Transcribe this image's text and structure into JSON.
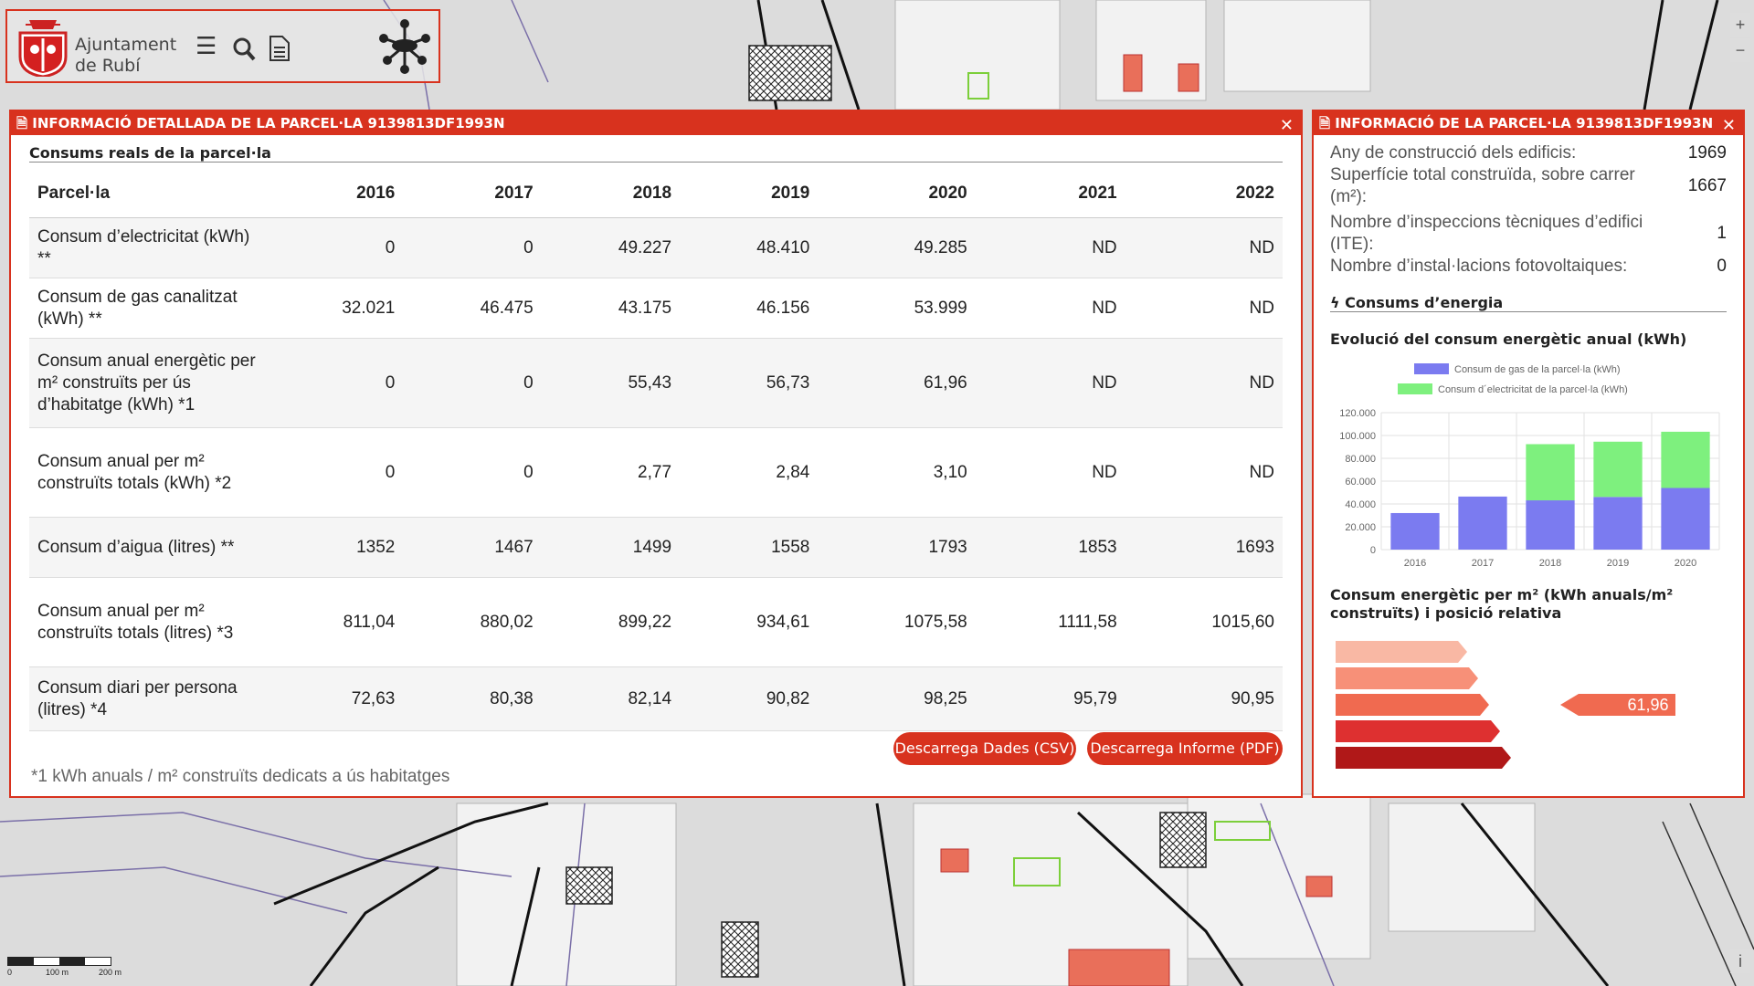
{
  "header": {
    "logo_line1": "Ajuntament",
    "logo_line2": "de Rubí"
  },
  "detail_panel": {
    "title": "INFORMACIÓ DETALLADA DE LA PARCEL·LA 9139813DF1993N",
    "section": "Consums reals de la parcel·la",
    "columns": [
      "Parcel·la",
      "2016",
      "2017",
      "2018",
      "2019",
      "2020",
      "2021",
      "2022"
    ],
    "rows": [
      {
        "label": "Consum d’electricitat (kWh) **",
        "values": [
          "0",
          "0",
          "49.227",
          "48.410",
          "49.285",
          "ND",
          "ND"
        ]
      },
      {
        "label": "Consum de gas canalitzat (kWh) **",
        "values": [
          "32.021",
          "46.475",
          "43.175",
          "46.156",
          "53.999",
          "ND",
          "ND"
        ]
      },
      {
        "label": "Consum anual energètic per m² construïts per ús d’habitatge (kWh) *1",
        "values": [
          "0",
          "0",
          "55,43",
          "56,73",
          "61,96",
          "ND",
          "ND"
        ]
      },
      {
        "label": "Consum anual per m² construïts totals (kWh) *2",
        "values": [
          "0",
          "0",
          "2,77",
          "2,84",
          "3,10",
          "ND",
          "ND"
        ]
      },
      {
        "label": "Consum d’aigua (litres) **",
        "values": [
          "1352",
          "1467",
          "1499",
          "1558",
          "1793",
          "1853",
          "1693"
        ]
      },
      {
        "label": "Consum anual per m² construïts totals (litres) *3",
        "values": [
          "811,04",
          "880,02",
          "899,22",
          "934,61",
          "1075,58",
          "1111,58",
          "1015,60"
        ]
      },
      {
        "label": "Consum diari per persona (litres) *4",
        "values": [
          "72,63",
          "80,38",
          "82,14",
          "90,82",
          "98,25",
          "95,79",
          "90,95"
        ]
      }
    ],
    "btn_csv": "Descarrega Dades (CSV)",
    "btn_pdf": "Descarrega Informe (PDF)",
    "footnote": "*1 kWh anuals / m² construïts dedicats a ús habitatges"
  },
  "info_panel": {
    "title": "INFORMACIÓ DE LA PARCEL·LA 9139813DF1993N",
    "rows": [
      {
        "label": "Any de construcció dels edificis:",
        "value": "1969"
      },
      {
        "label": "Superfície total construïda, sobre carrer (m²):",
        "value": "1667"
      },
      {
        "label": "Nombre d’inspeccions tècniques d’edifici (ITE):",
        "value": "1"
      },
      {
        "label": "Nombre d’instal·lacions fotovoltaiques:",
        "value": "0"
      }
    ],
    "energy_heading": "Consums d’energia",
    "chart_title": "Evolució del consum energètic anual (kWh)",
    "energy_per_m2_title": "Consum energètic per m² (kWh anuals/m² construïts) i posició relativa",
    "position_value": "61,96",
    "position_level": 3
  },
  "colors": {
    "accent": "#d8321e",
    "gas": "#7b7bf0",
    "electricity": "#7ef07e",
    "scale": [
      "#f9b8a4",
      "#f79078",
      "#f06a50",
      "#de3030",
      "#b01818"
    ]
  },
  "chart_data": {
    "type": "bar",
    "stacked": true,
    "categories": [
      "2016",
      "2017",
      "2018",
      "2019",
      "2020"
    ],
    "series": [
      {
        "name": "Consum de gas de la parcel·la (kWh)",
        "values": [
          32021,
          46475,
          43175,
          46156,
          53999
        ]
      },
      {
        "name": "Consum d´electricitat de la parcel·la (kWh)",
        "values": [
          0,
          0,
          49227,
          48410,
          49285
        ]
      }
    ],
    "yticks": [
      "120.000",
      "100.000",
      "80.000",
      "60.000",
      "40.000",
      "20.000",
      "0"
    ],
    "ylim": [
      0,
      120000
    ],
    "legend": "top",
    "grid": true
  },
  "map": {
    "scale_labels": [
      "0",
      "100 m",
      "200 m"
    ],
    "zoom_in": "+",
    "zoom_out": "−",
    "info": "i"
  }
}
